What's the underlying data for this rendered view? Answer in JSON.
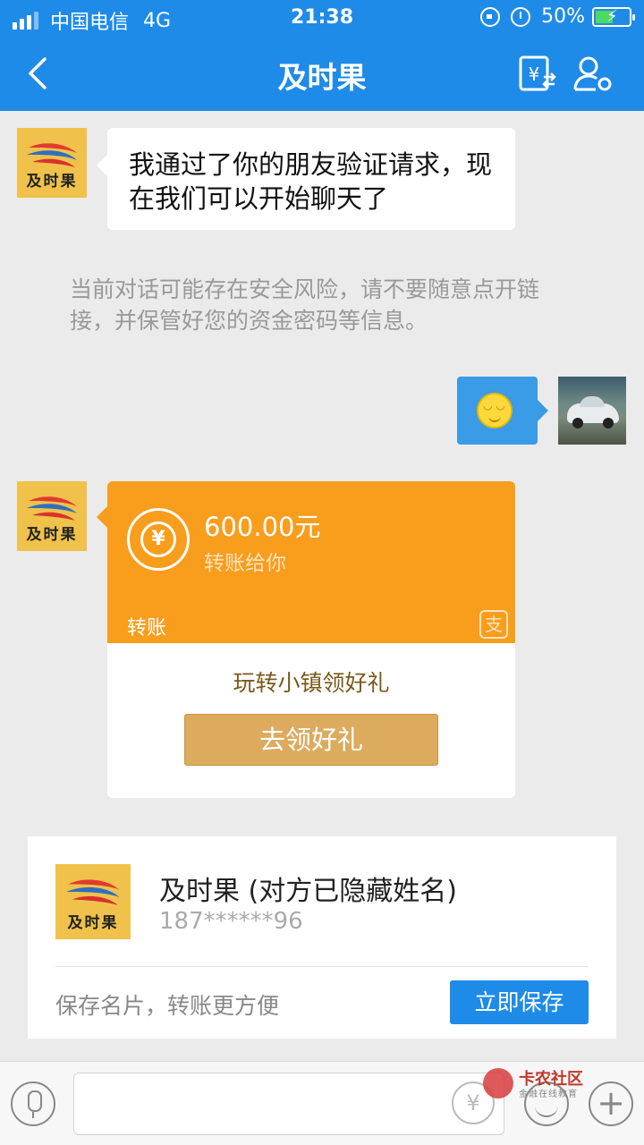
{
  "status_bar": {
    "carrier": "中国电信",
    "network": "4G",
    "time": "21:38",
    "battery": "50%",
    "battery_level": 0.5
  },
  "nav": {
    "title": "及时果",
    "back_icon": "chevron-left-icon",
    "transfer_icon": "yen-transfer-icon",
    "profile_icon": "user-settings-icon"
  },
  "contact_logo_text": "及时果",
  "messages": {
    "greeting": "我通过了你的朋友验证请求，现在我们可以开始聊天了",
    "security_notice": "当前对话可能存在安全风险，请不要随意点开链接，并保管好您的资金密码等信息。"
  },
  "transfer": {
    "amount": "600.00元",
    "subtitle": "转账给你",
    "label": "转账",
    "alipay_glyph": "支",
    "promo": "玩转小镇领好礼",
    "button": "去领好礼",
    "accent": "#f99d1c"
  },
  "contact_card": {
    "name": "及时果 (对方已隐藏姓名)",
    "phone": "187******96",
    "hint": "保存名片，转账更方便",
    "save_button": "立即保存"
  },
  "input_bar": {
    "voice_icon": "microphone-icon",
    "yen_glyph": "¥",
    "emoji_icon": "smiley-icon",
    "plus_glyph": "+"
  },
  "watermark": {
    "title": "卡农社区",
    "subtitle": "金融在线教育"
  },
  "colors": {
    "primary": "#1f8be8",
    "transfer_orange": "#f99d1c",
    "gift_button": "#dcab5e"
  }
}
